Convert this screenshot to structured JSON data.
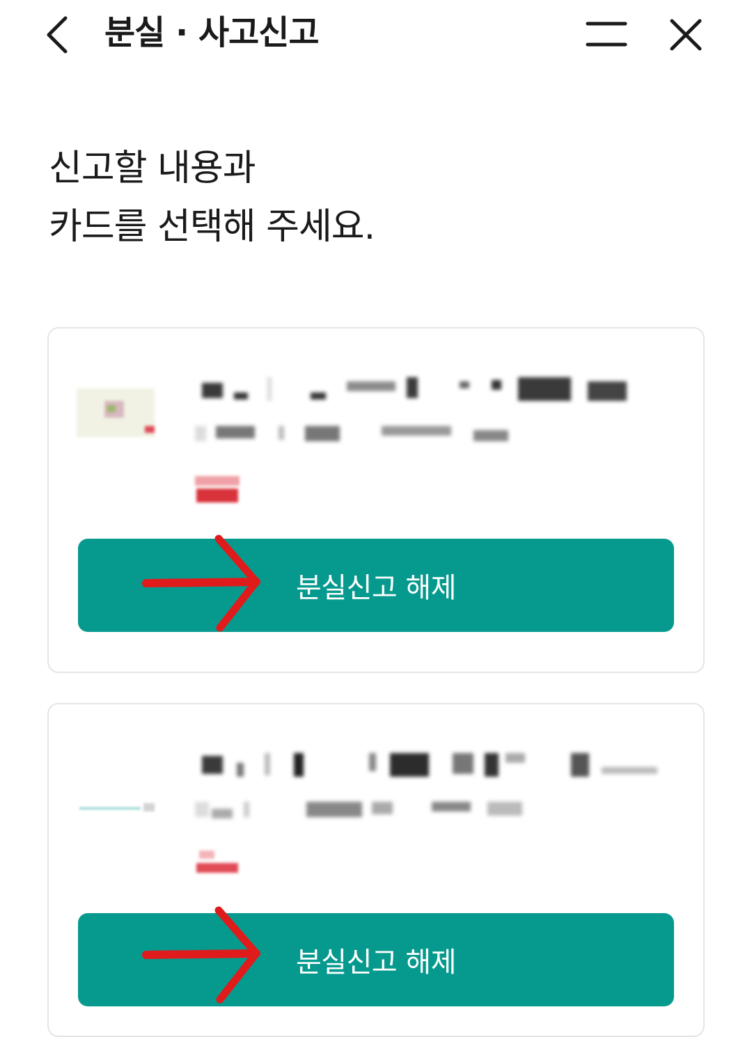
{
  "header": {
    "title": "분실 · 사고신고",
    "back_icon": "chevron-left-icon",
    "menu_icon": "menu-icon",
    "close_icon": "close-icon"
  },
  "instruction": {
    "line1": "신고할 내용과",
    "line2": "카드를 선택해 주세요."
  },
  "cards": [
    {
      "button_label": "분실신고 해제",
      "status_color": "#d8323a"
    },
    {
      "button_label": "분실신고 해제",
      "status_color": "#d8323a"
    }
  ],
  "colors": {
    "accent": "#069a8e",
    "annotation_arrow": "#e01b1b",
    "card_border": "#e5e5e5"
  }
}
